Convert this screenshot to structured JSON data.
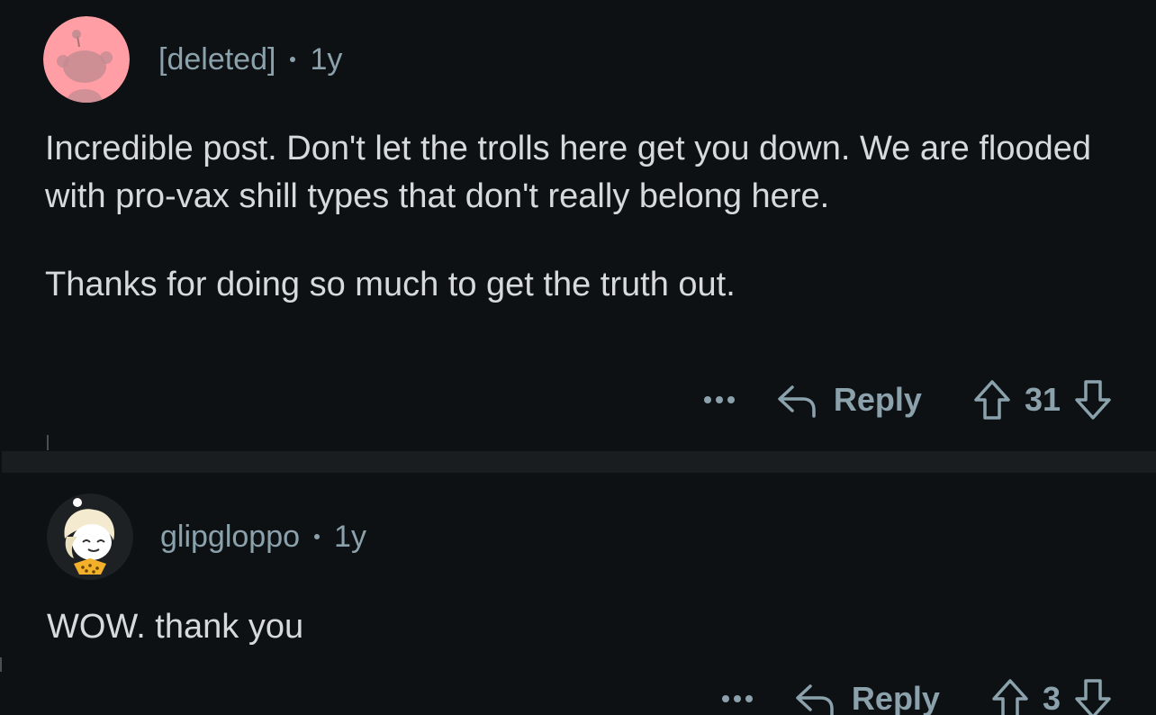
{
  "colors": {
    "background": "#0e1113",
    "separator": "#1a1d20",
    "text": "#d7dadc",
    "meta": "#8ba2ad",
    "deleted_avatar_bg": "#ff9ea5"
  },
  "comments": [
    {
      "username": "[deleted]",
      "age": "1y",
      "avatar_icon": "snoo-avatar-icon",
      "paragraphs": [
        "Incredible post. Don't let the trolls here get you down. We are flooded with pro-vax shill types that don't really belong here.",
        "Thanks for doing so much to get the truth out."
      ],
      "actions": {
        "more_icon": "more-options-icon",
        "reply_label": "Reply",
        "score": "31"
      }
    },
    {
      "username": "glipgloppo",
      "age": "1y",
      "avatar_icon": "user-avatar-icon",
      "paragraphs": [
        "WOW. thank you"
      ],
      "actions": {
        "more_icon": "more-options-icon",
        "reply_label": "Reply",
        "score": "3"
      }
    }
  ]
}
